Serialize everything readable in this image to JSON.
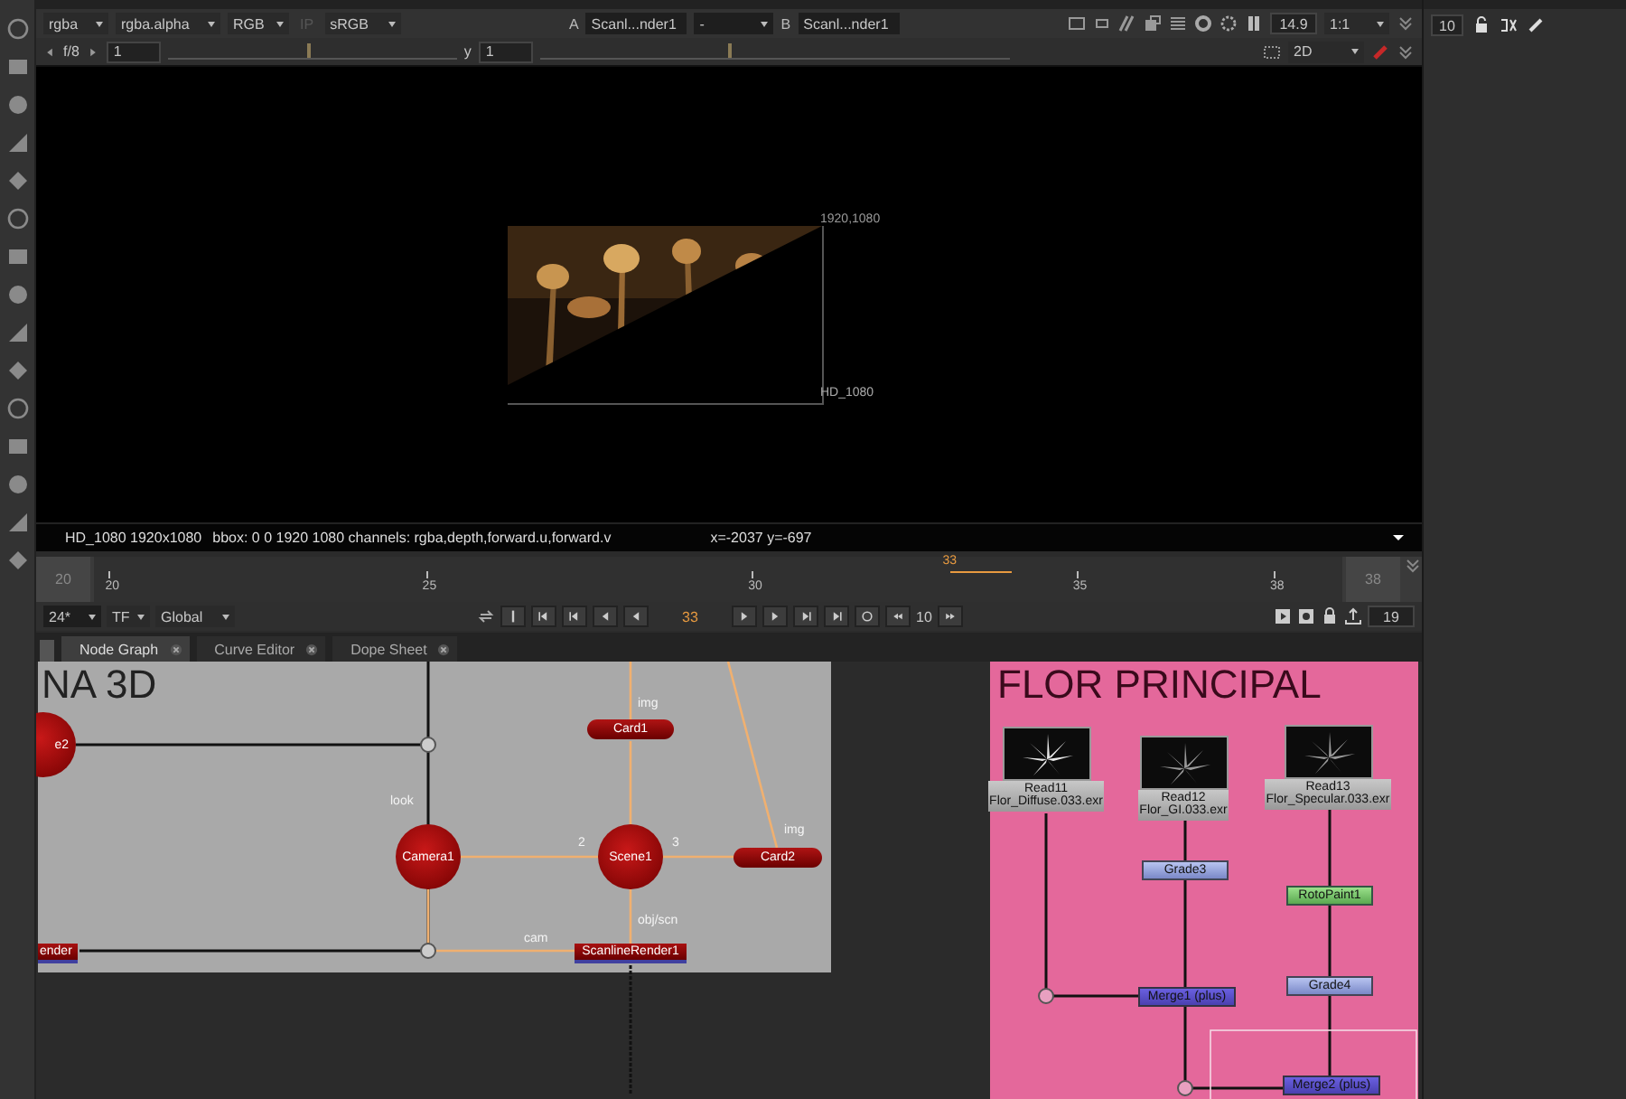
{
  "viewer_toolbar": {
    "channels": "rgba",
    "alpha_channel": "rgba.alpha",
    "display_channels": "RGB",
    "ip": {
      "label": "IP",
      "disabled": true
    },
    "lut": "sRGB",
    "input_a": {
      "label": "A",
      "value": "Scanl...nder1"
    },
    "wipe": "-",
    "input_b": {
      "label": "B",
      "value": "Scanl...nder1"
    },
    "zoom_value": "14.9",
    "scale": "1:1",
    "fstop": "f/8",
    "gain": "1",
    "gain_slider": {
      "level": 0.48
    },
    "gamma_label": "y",
    "gamma": "1",
    "gamma_slider": {
      "level": 0.4
    },
    "view_mode": "2D"
  },
  "viewer": {
    "format_corner": "1920,1080",
    "format_label": "HD_1080",
    "status_format": "HD_1080 1920x1080",
    "status_info": "bbox: 0 0 1920 1080 channels: rgba,depth,forward.u,forward.v",
    "status_cursor": "x=-2037 y=-697"
  },
  "timeline": {
    "start": "20",
    "end": "38",
    "ticks": [
      "20",
      "25",
      "30",
      "35",
      "38"
    ],
    "playhead_label": "33",
    "level": 0.722,
    "fps": "24*",
    "time_format": "TF",
    "range": "Global",
    "current_frame": "33",
    "increment": "10",
    "frame_count": "19"
  },
  "properties": {
    "max_panels": "10"
  },
  "tabs": [
    {
      "label": "Node Graph",
      "selected": true
    },
    {
      "label": "Curve Editor",
      "selected": false
    },
    {
      "label": "Dope Sheet",
      "selected": false
    }
  ],
  "backdrops": [
    {
      "title": "NA 3D",
      "color": "#a9a9a9"
    },
    {
      "title": "FLOR PRINCIPAL",
      "color": "#e4689b"
    }
  ],
  "nodes": [
    {
      "kind": "sphere",
      "label": "e2"
    },
    {
      "kind": "pill",
      "label": "Card1"
    },
    {
      "kind": "sphere",
      "label": "Camera1"
    },
    {
      "kind": "sphere",
      "label": "Scene1"
    },
    {
      "kind": "pill",
      "label": "Card2"
    },
    {
      "kind": "render",
      "label": "ender"
    },
    {
      "kind": "render",
      "label": "ScanlineRender1"
    },
    {
      "kind": "read",
      "label": "Read11",
      "file": "Flor_Diffuse.033.exr"
    },
    {
      "kind": "read",
      "label": "Read12",
      "file": "Flor_GI.033.exr"
    },
    {
      "kind": "read",
      "label": "Read13",
      "file": "Flor_Specular.033.exr"
    },
    {
      "kind": "grade",
      "label": "Grade3"
    },
    {
      "kind": "roto",
      "label": "RotoPaint1"
    },
    {
      "kind": "grade",
      "label": "Grade4"
    },
    {
      "kind": "merge",
      "label": "Merge1 (plus)"
    },
    {
      "kind": "merge",
      "label": "Merge2 (plus)"
    }
  ],
  "edge_labels": [
    "img",
    "look",
    "img",
    "2",
    "3",
    "obj/scn",
    "cam"
  ]
}
